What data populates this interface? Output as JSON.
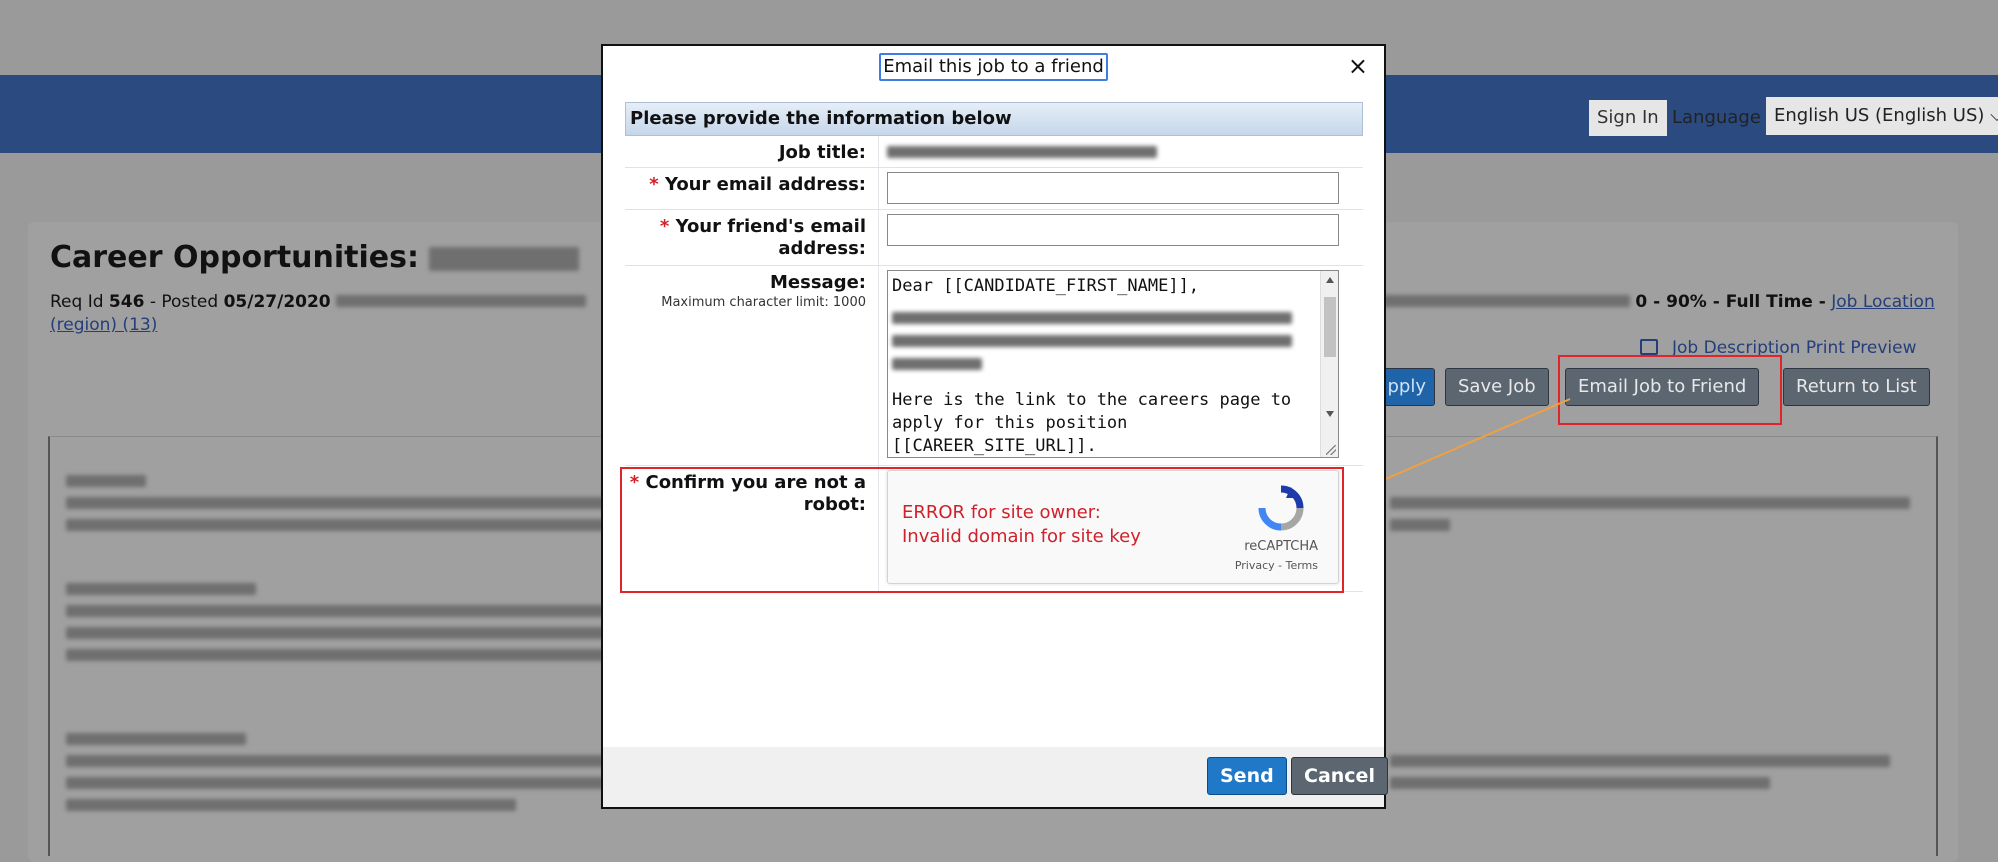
{
  "header": {
    "sign_in": "Sign In",
    "language_label": "Language",
    "language_value": "English US (English US)"
  },
  "page": {
    "title_prefix": "Career Opportunities:",
    "req_label": "Req Id",
    "req_id": "546",
    "posted_label": "- Posted",
    "posted_date": "05/27/2020",
    "employment": "0 - 90% - Full Time -",
    "job_location_link": "Job Location",
    "region_link": "(region) (13)",
    "print_preview": "Job Description Print Preview",
    "buttons": {
      "apply": "pply",
      "save": "Save Job",
      "email": "Email Job to Friend",
      "return": "Return to List"
    }
  },
  "modal": {
    "title": "Email this job to a friend",
    "close": "×",
    "section": "Please provide the information below",
    "fields": {
      "job_title_label": "Job title:",
      "email_label": "Your email address:",
      "friend_email_label": "Your friend's email address:",
      "message_label": "Message:",
      "message_hint": "Maximum character limit: 1000",
      "message_line1": "Dear [[CANDIDATE_FIRST_NAME]],",
      "message_line2": "Here is the link to the careers page to apply for this position [[CAREER_SITE_URL]].",
      "robot_label": "Confirm you are not a robot:"
    },
    "required_mark": "*",
    "captcha": {
      "error_line1": "ERROR for site owner:",
      "error_line2": "Invalid domain for site key",
      "brand": "reCAPTCHA",
      "terms": "Privacy - Terms"
    },
    "send": "Send",
    "cancel": "Cancel"
  },
  "colors": {
    "top_bar": "#2b4a80",
    "primary_button": "#1f78c8",
    "secondary_button": "#5b6670",
    "highlight": "#e0242a",
    "arrow": "#f0a040"
  }
}
